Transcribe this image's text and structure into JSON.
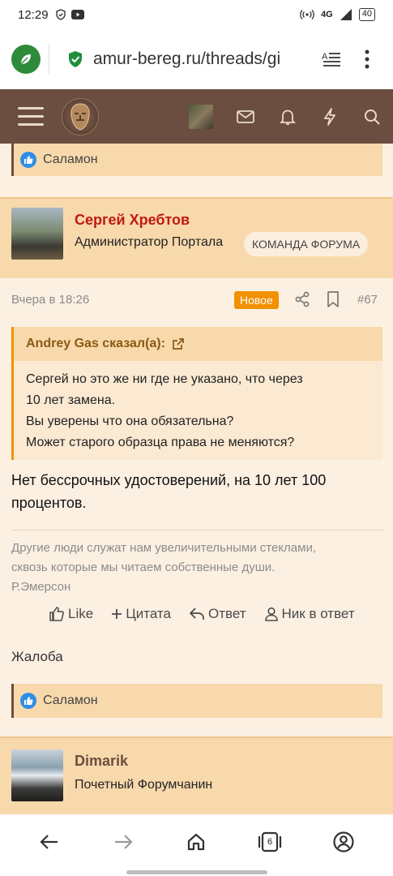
{
  "status_bar": {
    "time": "12:29",
    "network": "4G",
    "battery": "40"
  },
  "browser": {
    "url": "amur-bereg.ru/threads/gi"
  },
  "site_header": {
    "brand_color": "#6b4e3f"
  },
  "reaction_top": {
    "name": "Саламон"
  },
  "post": {
    "username": "Сергей Хребтов",
    "user_title": "Администратор Портала",
    "badge": "КОМАНДА ФОРУМА",
    "date": "Вчера в 18:26",
    "new_label": "Новое",
    "number": "#67",
    "quote": {
      "author": "Andrey Gas сказал(а):",
      "lines": [
        "Сергей но это же ни где не указано, что через",
        "10 лет замена.",
        "Вы уверены что она обязательна?",
        "Может старого образца права не меняются?"
      ]
    },
    "message_lines": [
      "Нет бессрочных удостоверений, на 10 лет 100",
      "процентов."
    ],
    "signature_lines": [
      "Другие люди служат нам увеличительными стеклами,",
      "сквозь которые мы читаем собственные души.",
      "Р.Эмерсон"
    ],
    "actions": {
      "like": "Like",
      "quote": "Цитата",
      "reply": "Ответ",
      "nick": "Ник в ответ"
    },
    "report": "Жалоба",
    "reaction": {
      "name": "Саламон"
    }
  },
  "next_post": {
    "username": "Dimarik",
    "user_title": "Почетный Форумчанин"
  },
  "bottom_nav": {
    "tabs_count": "6"
  },
  "colors": {
    "accent_orange": "#f29100",
    "username_red": "#c01a12",
    "like_blue": "#2f8ee8"
  }
}
